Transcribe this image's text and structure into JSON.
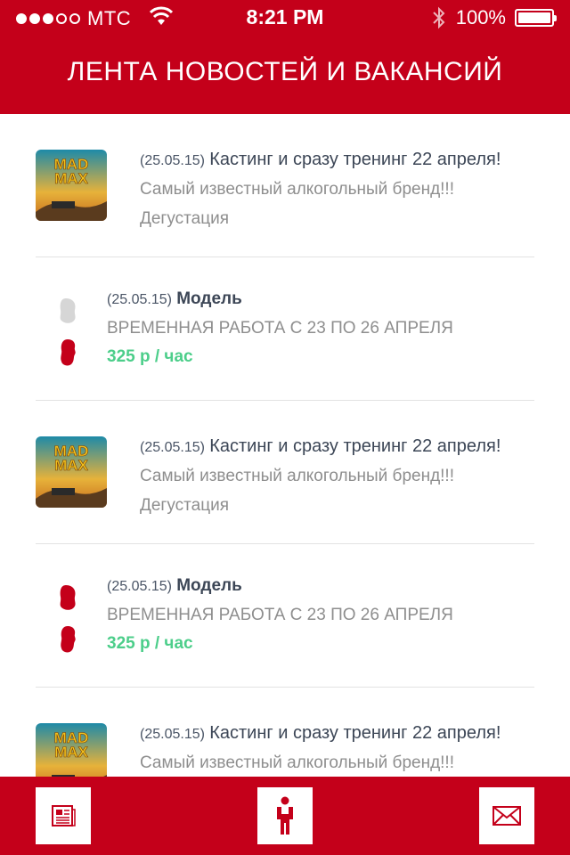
{
  "status_bar": {
    "carrier": "МТС",
    "time": "8:21 PM",
    "battery": "100%"
  },
  "header": {
    "title": "ЛЕНТА НОВОСТЕЙ И ВАКАНСИЙ"
  },
  "feed": [
    {
      "type": "news",
      "thumb": "mad-max-poster",
      "date": "(25.05.15)",
      "title": "Кастинг и сразу тренинг 22 апреля!",
      "subtitle": "Самый известный алкогольный бренд!!!",
      "category": "Дегустация"
    },
    {
      "type": "job",
      "icons": [
        "female-silhouette-gray-icon",
        "male-silhouette-red-icon"
      ],
      "date": "(25.05.15)",
      "title": "Модель",
      "subtitle": "ВРЕМЕННАЯ РАБОТА С 23 ПО 26 АПРЕЛЯ",
      "pay": "325 р / час"
    },
    {
      "type": "news",
      "thumb": "mad-max-poster",
      "date": "(25.05.15)",
      "title": "Кастинг и сразу тренинг 22 апреля!",
      "subtitle": "Самый известный алкогольный бренд!!!",
      "category": "Дегустация"
    },
    {
      "type": "job",
      "icons": [
        "female-silhouette-red-icon",
        "male-silhouette-red-icon"
      ],
      "date": "(25.05.15)",
      "title": "Модель",
      "subtitle": "ВРЕМЕННАЯ РАБОТА С 23 ПО 26 АПРЕЛЯ",
      "pay": "325 р / час"
    },
    {
      "type": "news",
      "thumb": "mad-max-poster",
      "date": "(25.05.15)",
      "title": "Кастинг и сразу тренинг 22 апреля!",
      "subtitle": "Самый известный алкогольный бренд!!!"
    }
  ],
  "tabbar": {
    "tabs": [
      "news-tab",
      "jobs-tab",
      "messages-tab"
    ]
  },
  "colors": {
    "brand_red": "#c4001a",
    "pay_green": "#4cce8a",
    "silhouette_gray": "#d6d6d6"
  }
}
